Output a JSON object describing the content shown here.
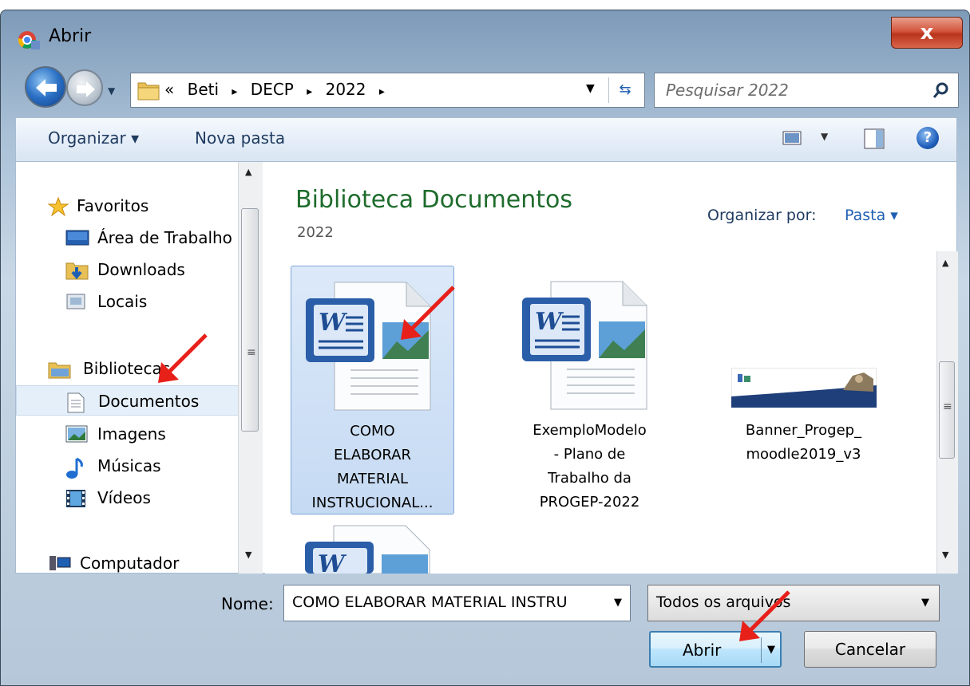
{
  "window": {
    "title": "Abrir",
    "close_label": "x"
  },
  "address": {
    "overflow": "«",
    "crumbs": [
      "Beti",
      "DECP",
      "2022"
    ],
    "separator": "▸"
  },
  "search": {
    "placeholder": "Pesquisar 2022"
  },
  "toolbar": {
    "organize_label": "Organizar ▾",
    "new_folder_label": "Nova pasta",
    "help_label": "?"
  },
  "nav": {
    "favorites": "Favoritos",
    "desktop": "Área de Trabalho",
    "downloads": "Downloads",
    "places": "Locais",
    "libraries": "Bibliotecas",
    "documents": "Documentos",
    "images": "Imagens",
    "music": "Músicas",
    "videos": "Vídeos",
    "computer": "Computador"
  },
  "library": {
    "title": "Biblioteca Documentos",
    "subtitle": "2022",
    "arrange_label": "Organizar por:",
    "arrange_value": "Pasta ▾"
  },
  "files": [
    {
      "lines": [
        "COMO",
        "ELABORAR",
        "MATERIAL",
        "INSTRUCIONAL..."
      ],
      "icon": "word-document-icon"
    },
    {
      "lines": [
        "ExemploModelo",
        "- Plano de",
        "Trabalho da",
        "PROGEP-2022"
      ],
      "icon": "word-document-icon"
    },
    {
      "lines": [
        "Banner_Progep_",
        "moodle2019_v3"
      ],
      "icon": "image-thumbnail-icon"
    }
  ],
  "bottom": {
    "name_label": "Nome:",
    "name_value": "COMO ELABORAR MATERIAL INSTRU",
    "filetype_value": "Todos os arquivos",
    "open_label": "Abrir",
    "cancel_label": "Cancelar"
  },
  "colors": {
    "library_title": "#1e6c2c",
    "annotation_arrow": "#e8201a",
    "selection": "#c5daf3"
  }
}
